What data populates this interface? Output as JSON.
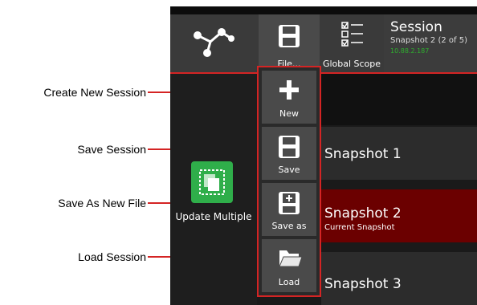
{
  "callouts": {
    "create": "Create New Session",
    "save": "Save Session",
    "save_as": "Save As New File",
    "load": "Load Session"
  },
  "toolbar": {
    "network_icon": "network-icon",
    "file_label": "File...",
    "global_scope_label": "Global Scope",
    "session_title": "Session",
    "session_subtitle": "Snapshot 2 (2 of 5)",
    "session_ip": "10.88.2.187"
  },
  "left_panel": {
    "update_multiple_label": "Update Multiple"
  },
  "file_menu": {
    "items": [
      {
        "label": "New",
        "icon": "plus-icon"
      },
      {
        "label": "Save",
        "icon": "floppy-disk-icon"
      },
      {
        "label": "Save as",
        "icon": "floppy-plus-icon"
      },
      {
        "label": "Load",
        "icon": "folder-open-icon"
      }
    ]
  },
  "snapshots": [
    {
      "name": "Snapshot 1",
      "status": ""
    },
    {
      "name": "Snapshot 2",
      "status": "Current Snapshot"
    },
    {
      "name": "Snapshot 3",
      "status": ""
    }
  ],
  "colors": {
    "accent_red": "#d42424",
    "current_row": "#6b0000",
    "update_green": "#2fae4a",
    "ip_green": "#2fae2f"
  }
}
